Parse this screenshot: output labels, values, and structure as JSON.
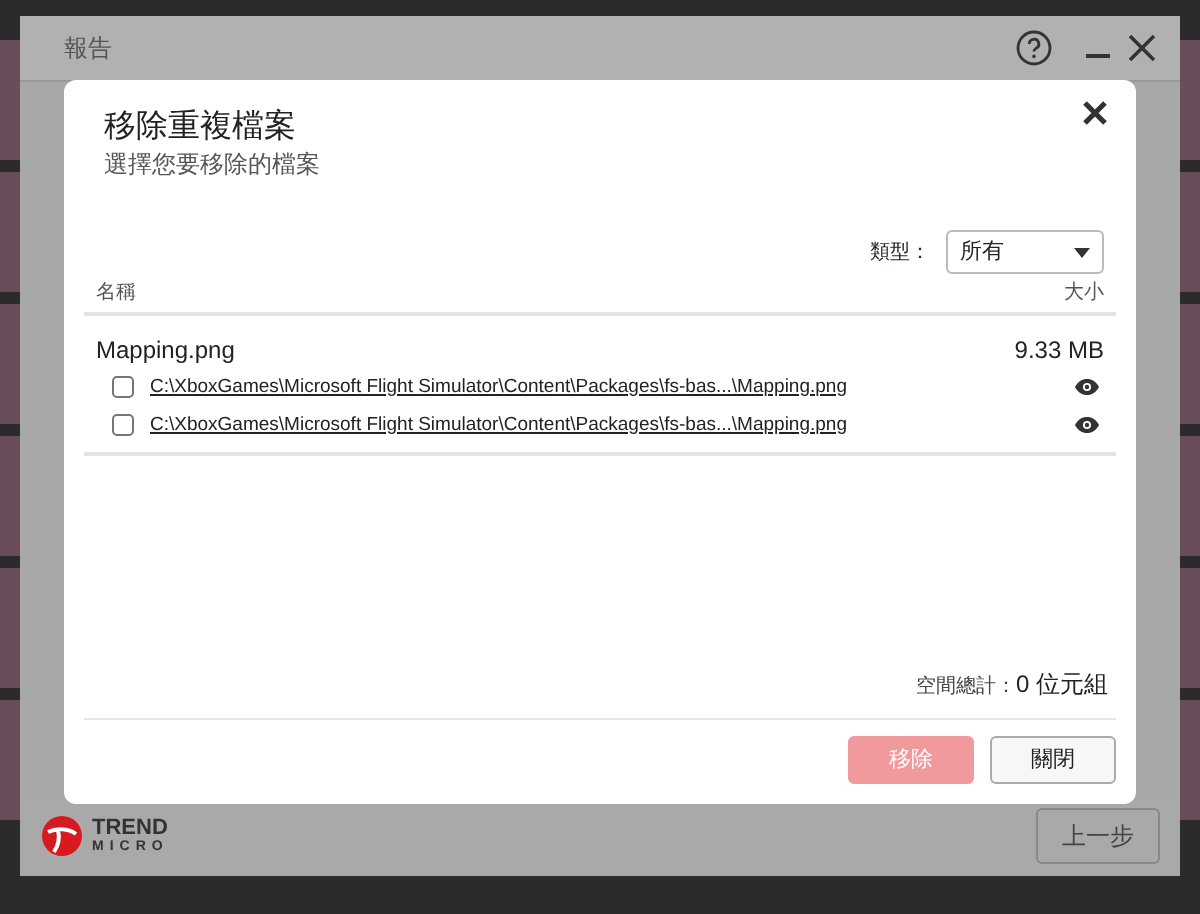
{
  "app_window": {
    "title": "報告",
    "logo": {
      "line_1": "TREND",
      "line_2": "MICRO"
    },
    "back_button": "上一步"
  },
  "dialog": {
    "title": "移除重複檔案",
    "subtitle": "選擇您要移除的檔案",
    "filter": {
      "label": "類型：",
      "value": "所有"
    },
    "columns": [
      "名稱",
      "大小"
    ],
    "groups": [
      {
        "name": "Mapping.png",
        "size": "9.33 MB",
        "files": [
          {
            "path": "C:\\XboxGames\\Microsoft Flight Simulator\\Content\\Packages\\fs-bas...\\Mapping.png",
            "checked": false
          },
          {
            "path": "C:\\XboxGames\\Microsoft Flight Simulator\\Content\\Packages\\fs-bas...\\Mapping.png",
            "checked": false
          }
        ]
      }
    ],
    "total": {
      "label": "空間總計：",
      "value": "0 位元組"
    },
    "buttons": [
      {
        "label": "移除",
        "kind": "primary",
        "disabled": true
      },
      {
        "label": "關閉",
        "kind": "secondary",
        "disabled": false
      }
    ]
  }
}
